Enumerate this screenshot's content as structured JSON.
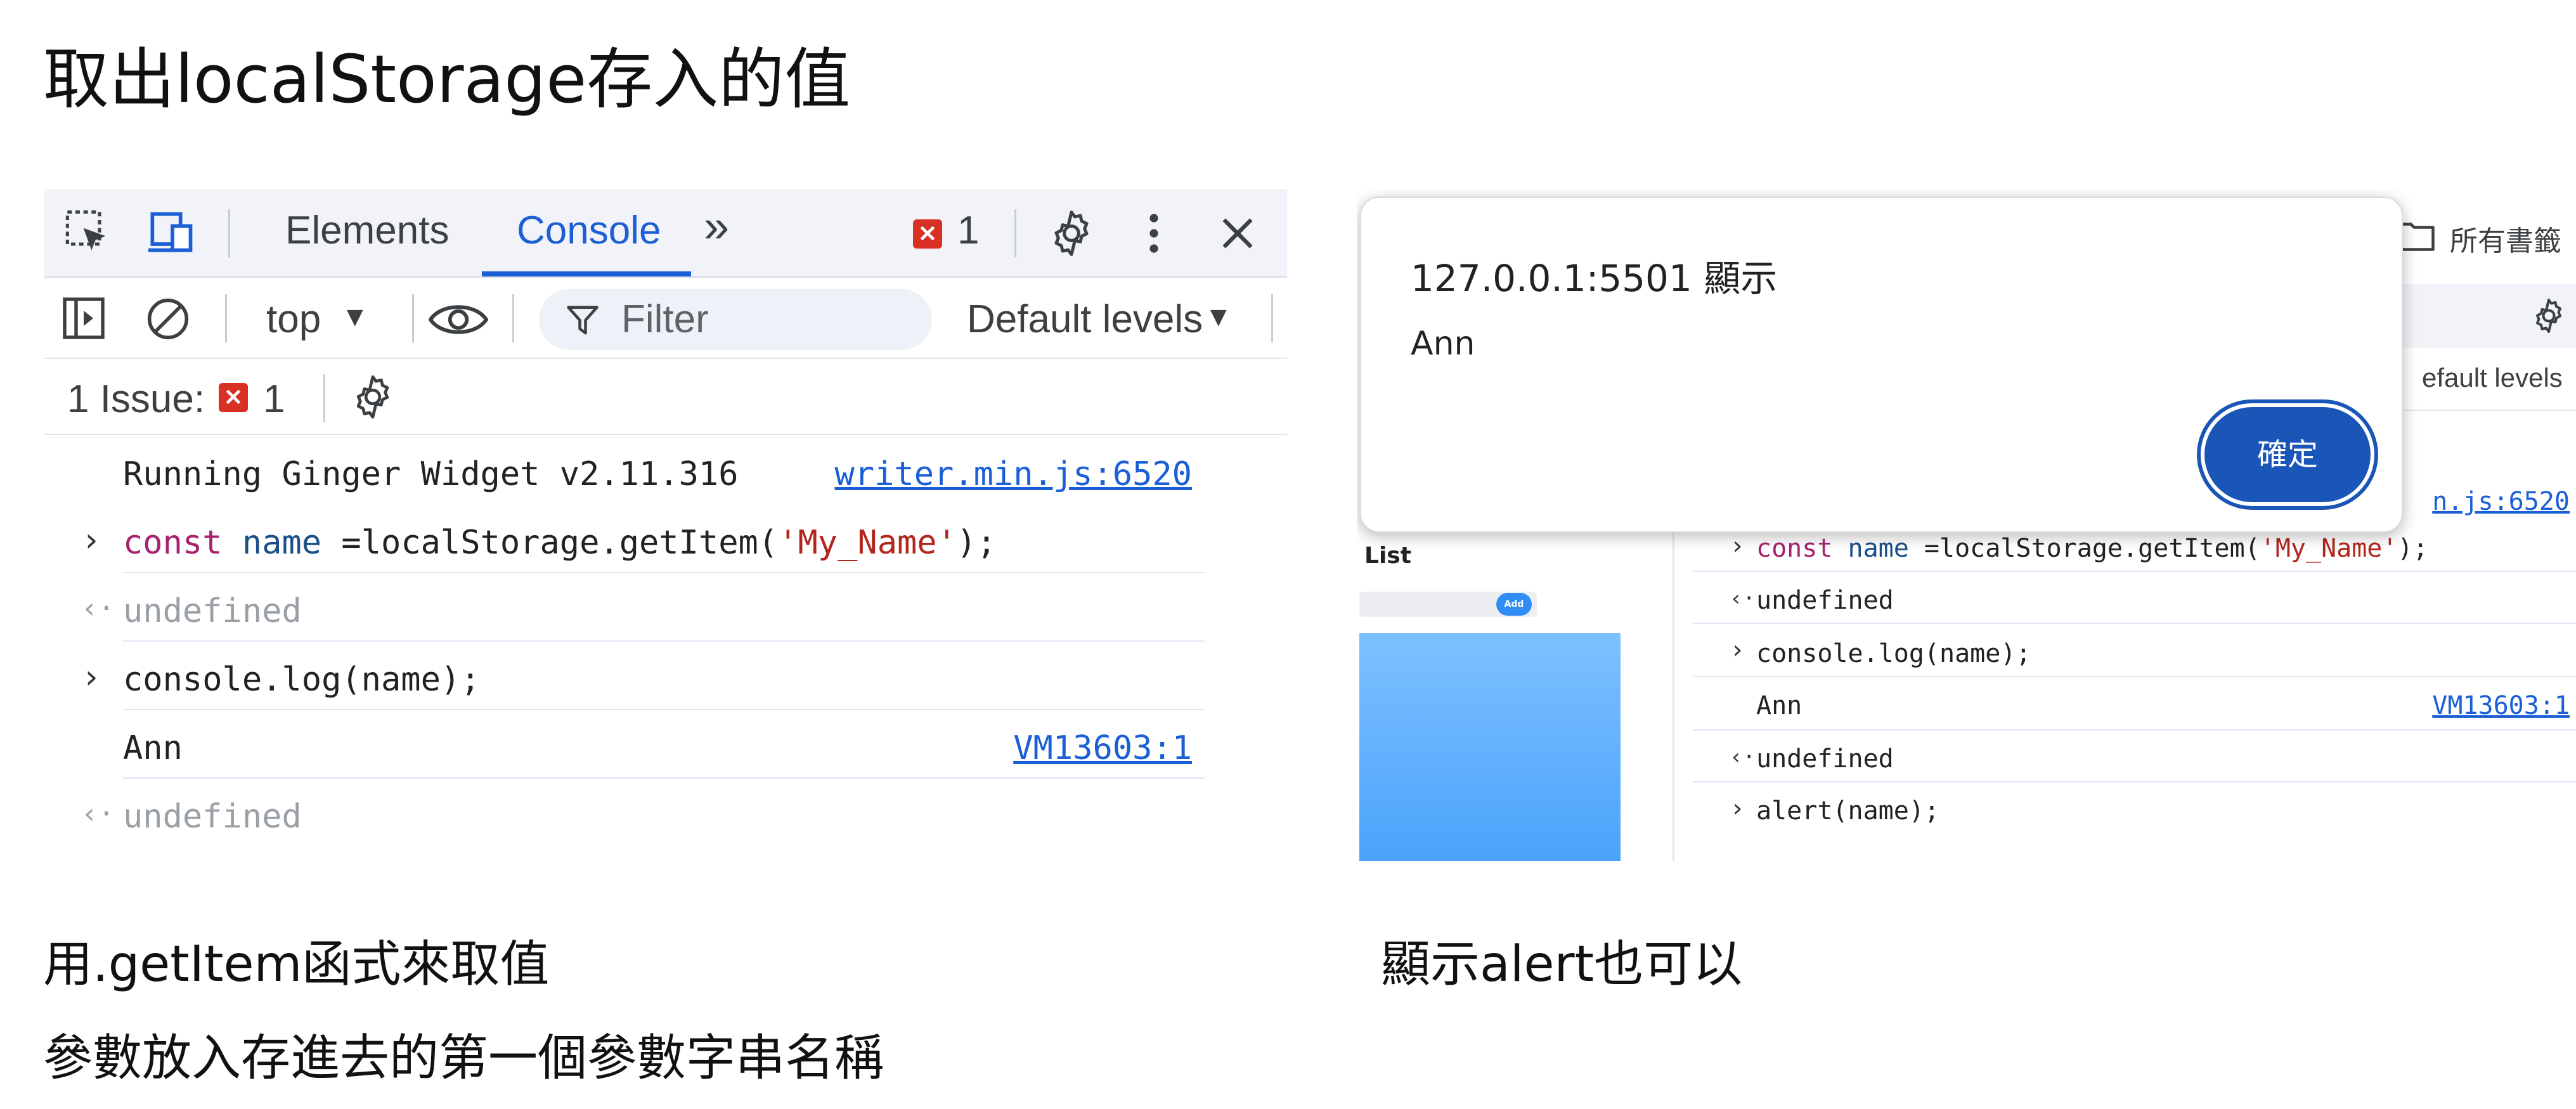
{
  "slide": {
    "title": "取出localStorage存入的值",
    "caption_left_1": "用.getItem函式來取值",
    "caption_left_2": "參數放入存進去的第一個參數字串名稱",
    "caption_right": "顯示alert也可以"
  },
  "devtools": {
    "tabs": {
      "elements": "Elements",
      "console": "Console",
      "more": "»"
    },
    "error_count": "1",
    "toolbar": {
      "context": "top",
      "filter_placeholder": "Filter",
      "levels": "Default levels"
    },
    "issues": {
      "label": "1 Issue:",
      "count": "1"
    },
    "console": {
      "rows": [
        {
          "text": "Running Ginger Widget v2.11.316",
          "source": "writer.min.js:6520"
        },
        {
          "kw": "const",
          "var": "name",
          "rest1": " =localStorage.getItem(",
          "str": "'My_Name'",
          "rest2": ");"
        },
        {
          "text": "undefined"
        },
        {
          "text": "console.log(name);"
        },
        {
          "text": "Ann",
          "source": "VM13603:1"
        },
        {
          "text": "undefined"
        }
      ]
    },
    "colors": {
      "accent": "#1a5fd6",
      "error": "#d93025"
    }
  },
  "right": {
    "bookmarks_label": "所有書籤",
    "levels_partial": "efault levels",
    "source_partial": "n.js:6520",
    "page": {
      "list_title": "List",
      "add_label": "Add"
    },
    "console": {
      "rows": [
        {
          "kw": "const",
          "var": "name",
          "rest1": " =localStorage.getItem(",
          "str": "'My_Name'",
          "rest2": ");"
        },
        {
          "text": "undefined"
        },
        {
          "text": "console.log(name);"
        },
        {
          "text": "Ann",
          "source": "VM13603:1"
        },
        {
          "text": "undefined"
        },
        {
          "text": "alert(name);"
        }
      ]
    },
    "dialog": {
      "title": "127.0.0.1:5501 顯示",
      "message": "Ann",
      "ok": "確定"
    }
  }
}
